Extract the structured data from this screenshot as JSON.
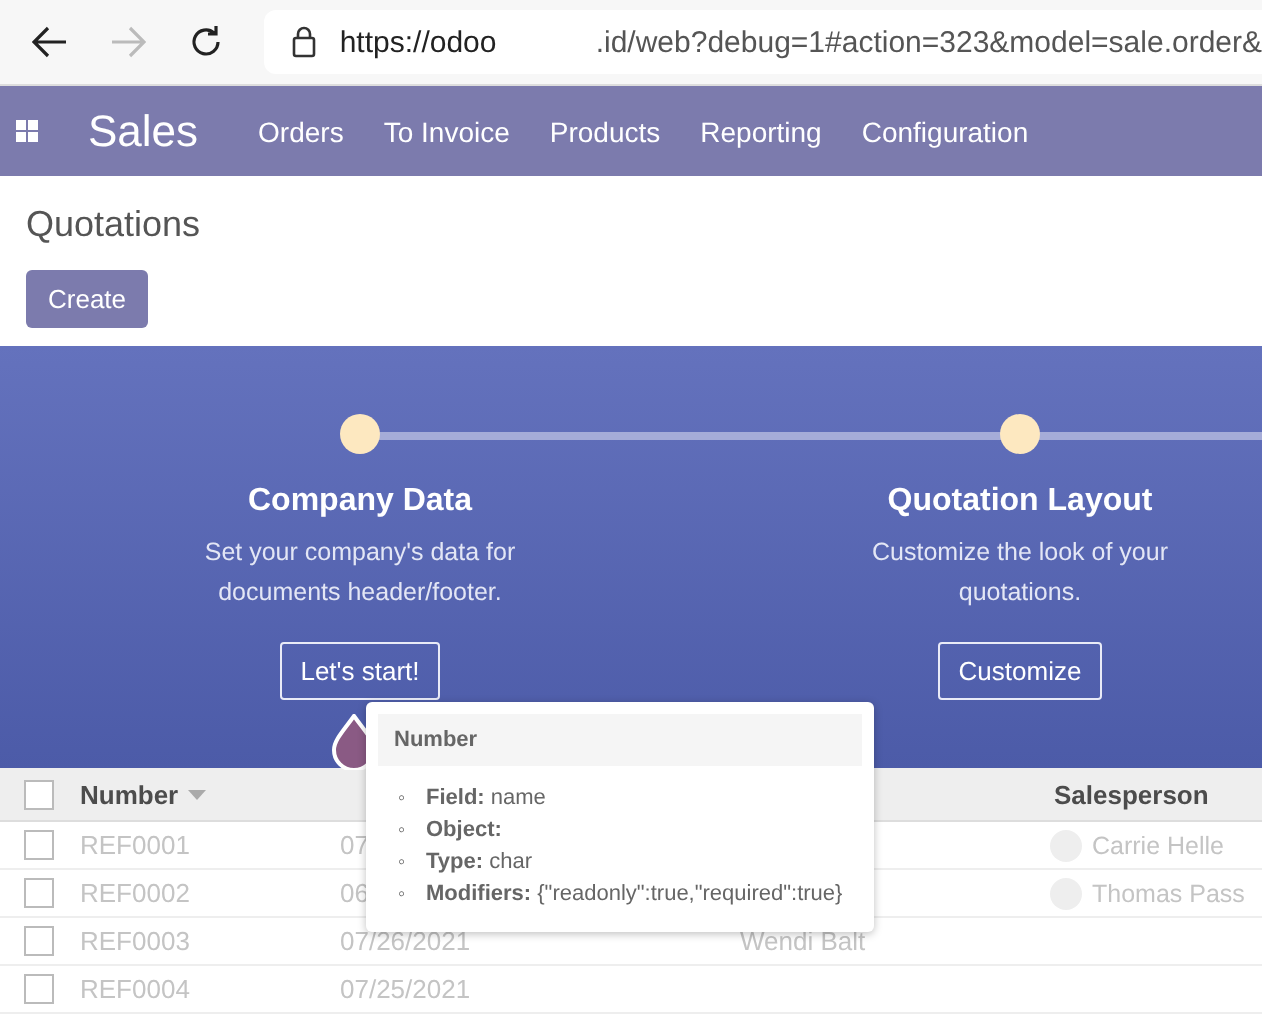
{
  "browser": {
    "url_host": "https://odoo",
    "url_rest": ".id/web?debug=1#action=323&model=sale.order&"
  },
  "navbar": {
    "app": "Sales",
    "menu": [
      "Orders",
      "To Invoice",
      "Products",
      "Reporting",
      "Configuration"
    ]
  },
  "page": {
    "title": "Quotations",
    "create": "Create"
  },
  "steps": [
    {
      "title": "Company Data",
      "text": "Set your company's data for documents header/footer.",
      "button": "Let's start!"
    },
    {
      "title": "Quotation Layout",
      "text": "Customize the look of your quotations.",
      "button": "Customize"
    }
  ],
  "table": {
    "select_all_checked": false,
    "columns": [
      "Number",
      "",
      "",
      "Salesperson"
    ],
    "rows": [
      {
        "checked": false,
        "cells": [
          "REF0001",
          "07",
          "",
          "Carrie Helle"
        ]
      },
      {
        "checked": false,
        "cells": [
          "REF0002",
          "06",
          "",
          "Thomas Pass"
        ]
      },
      {
        "checked": false,
        "cells": [
          "REF0003",
          "07/26/2021",
          "Wendi Balt",
          ""
        ]
      },
      {
        "checked": false,
        "cells": [
          "REF0004",
          "07/25/2021",
          "",
          ""
        ]
      }
    ]
  },
  "tooltip": {
    "title": "Number",
    "items": [
      {
        "bullet": "◦",
        "label": "Field:",
        "value": "name"
      },
      {
        "bullet": "◦",
        "label": "Object:",
        "value": ""
      },
      {
        "bullet": "◦",
        "label": "Type:",
        "value": "char"
      },
      {
        "bullet": "◦",
        "label": "Modifiers:",
        "value": "{\"readonly\":true,\"required\":true}"
      }
    ]
  }
}
